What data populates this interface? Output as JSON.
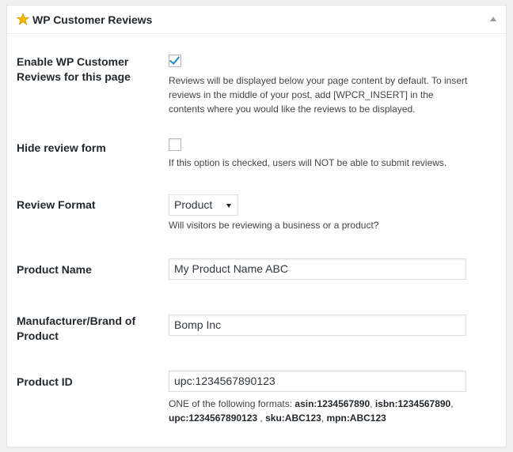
{
  "metabox": {
    "title": "WP Customer Reviews",
    "icon": "star-icon",
    "toggle_icon": "arrow-up-icon"
  },
  "fields": {
    "enable": {
      "label": "Enable WP Customer Reviews for this page",
      "checked": true,
      "description": "Reviews will be displayed below your page content by default. To insert reviews in the middle of your post, add [WPCR_INSERT] in the contents where you would like the reviews to be displayed."
    },
    "hide_form": {
      "label": "Hide review form",
      "checked": false,
      "description": "If this option is checked, users will NOT be able to submit reviews."
    },
    "review_format": {
      "label": "Review Format",
      "selected": "Product",
      "description": "Will visitors be reviewing a business or a product?"
    },
    "product_name": {
      "label": "Product Name",
      "value": "My Product Name ABC"
    },
    "brand": {
      "label": "Manufacturer/Brand of Product",
      "value": "Bomp Inc"
    },
    "product_id": {
      "label": "Product ID",
      "value": "upc:1234567890123",
      "description_prefix": "ONE of the following formats: ",
      "formats": [
        "asin:1234567890",
        "isbn:1234567890",
        "upc:1234567890123",
        "sku:ABC123",
        "mpn:ABC123"
      ]
    }
  },
  "colors": {
    "accent": "#1e8cbe",
    "star": "#f5b800"
  }
}
